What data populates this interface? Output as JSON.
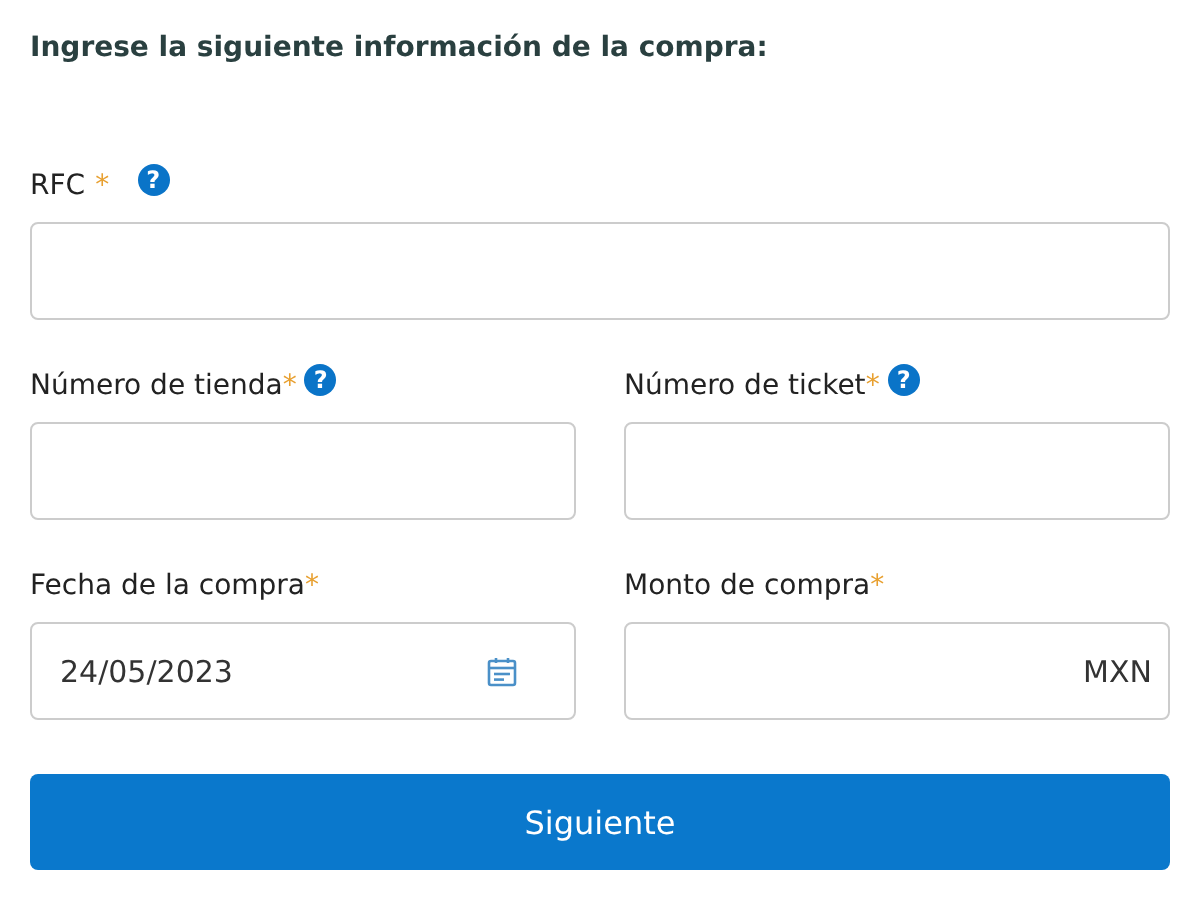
{
  "heading": "Ingrese la siguiente información de la compra:",
  "rows": [
    {
      "fields": [
        {
          "kind": "text",
          "label": "RFC",
          "required_mark": "*",
          "help": "?"
        }
      ]
    },
    {
      "fields": [
        {
          "kind": "text",
          "label": "Número de tienda",
          "required_mark": "*",
          "help": "?"
        },
        {
          "kind": "text",
          "label": "Número de ticket",
          "required_mark": "*",
          "help": "?"
        }
      ]
    },
    {
      "fields": [
        {
          "kind": "date",
          "label": "Fecha de la compra",
          "required_mark": "*",
          "value": "24/05/2023"
        },
        {
          "kind": "amount",
          "label": "Monto de compra",
          "required_mark": "*",
          "suffix": "MXN"
        }
      ]
    }
  ],
  "submit": "Siguiente"
}
